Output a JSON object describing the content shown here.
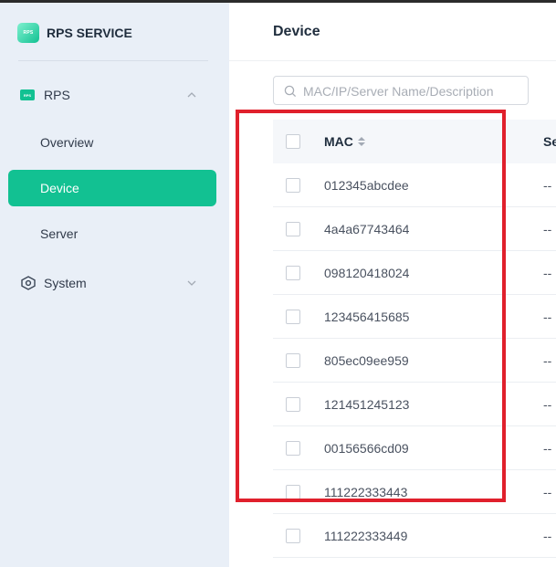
{
  "brand": {
    "logo_text": "RPS",
    "name": "RPS SERVICE"
  },
  "sidebar": {
    "groups": [
      {
        "label": "RPS",
        "icon": "rps-icon",
        "expanded": true
      },
      {
        "label": "System",
        "icon": "hexagon-gear-icon",
        "expanded": false
      }
    ],
    "items": [
      {
        "label": "Overview",
        "active": false
      },
      {
        "label": "Device",
        "active": true
      },
      {
        "label": "Server",
        "active": false
      }
    ]
  },
  "main": {
    "title": "Device",
    "search": {
      "placeholder": "MAC/IP/Server Name/Description",
      "value": ""
    },
    "table": {
      "columns": [
        "MAC",
        "Se"
      ],
      "rows": [
        {
          "mac": "012345abcdee",
          "second": "--"
        },
        {
          "mac": "4a4a67743464",
          "second": "--"
        },
        {
          "mac": "098120418024",
          "second": "--"
        },
        {
          "mac": "123456415685",
          "second": "--"
        },
        {
          "mac": "805ec09ee959",
          "second": "--"
        },
        {
          "mac": "121451245123",
          "second": "--"
        },
        {
          "mac": "00156566cd09",
          "second": "--"
        },
        {
          "mac": "111222333443",
          "second": "--"
        },
        {
          "mac": "111222333449",
          "second": "--"
        }
      ]
    }
  },
  "colors": {
    "accent": "#12c192",
    "sidebar_bg": "#e9eff7",
    "highlight": "#e0202c"
  }
}
